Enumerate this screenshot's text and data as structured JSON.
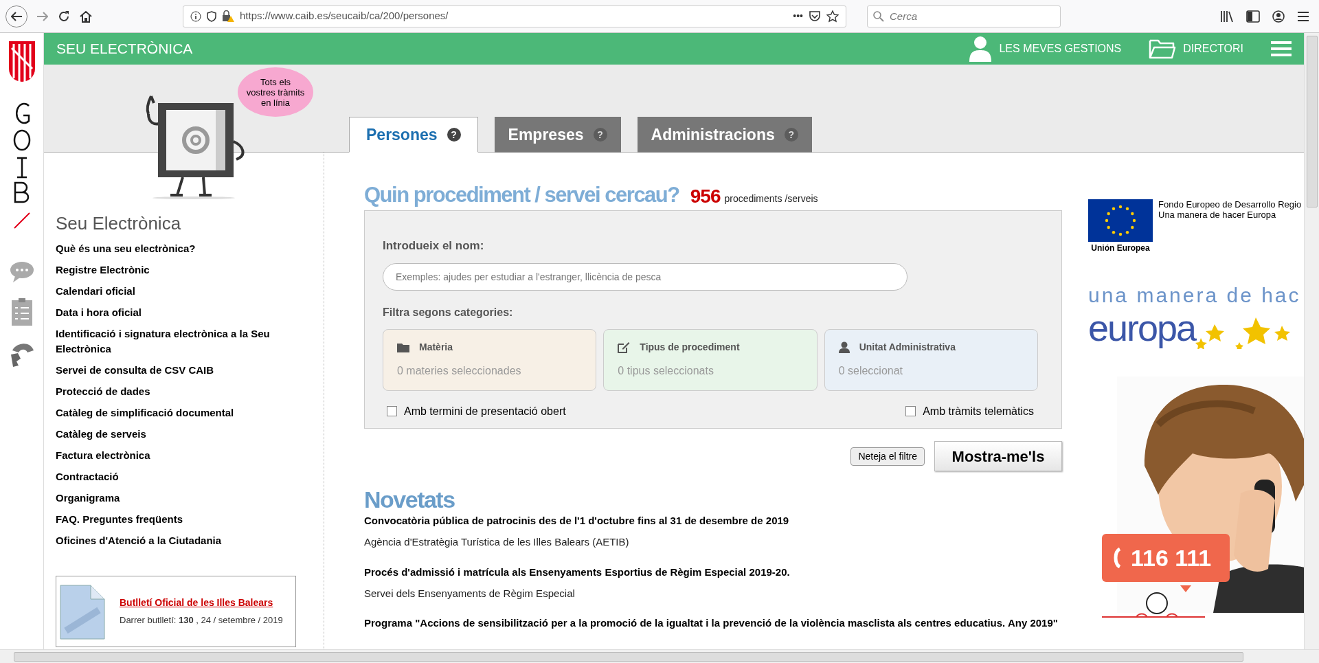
{
  "browser": {
    "url": "https://www.caib.es/seucaib/ca/200/persones/",
    "more": "•••",
    "search_placeholder": "Cerca"
  },
  "header": {
    "title": "SEU ELECTRÒNICA",
    "links": [
      {
        "kind": "user",
        "label": "LES MEVES GESTIONS"
      },
      {
        "kind": "folder",
        "label": "DIRECTORI"
      }
    ]
  },
  "banner": {
    "bubble": "Tots els vostres tràmits en línia"
  },
  "tabs": [
    {
      "label": "Persones",
      "help": "?",
      "selected": true
    },
    {
      "label": "Empreses",
      "help": "?",
      "selected": false
    },
    {
      "label": "Administracions",
      "help": "?",
      "selected": false
    }
  ],
  "sidebar": {
    "title": "Seu Electrònica",
    "links": [
      "Què és una seu electrònica?",
      "Registre Electrònic",
      "Calendari oficial",
      "Data i hora oficial",
      "Identificació i signatura electrònica a la Seu Electrònica",
      "Servei de consulta de CSV CAIB",
      "Protecció de dades",
      "Catàleg de simplificació documental",
      "Catàleg de serveis",
      "Factura electrònica",
      "Contractació",
      "Organigrama",
      "FAQ. Preguntes freqüents",
      "Oficines d'Atenció a la Ciutadania"
    ],
    "boib": {
      "title": "Butlletí Oficial de les Illes Balears",
      "text": "Darrer butlletí: **130** , 24 / setembre / 2019"
    }
  },
  "search": {
    "heading": "Quin procediment / servei cercau?",
    "count": "956",
    "count_label": "procediments /serveis",
    "name_label": "Introdueix el nom:",
    "placeholder": "Exemples: ajudes per estudiar a l'estranger, llicència de pesca",
    "filter_label": "Filtra segons categories:",
    "categories": [
      {
        "kind": "folder",
        "title": "Matèria",
        "summary": "0  materies seleccionades",
        "color": "#f7f0e6"
      },
      {
        "kind": "edit",
        "title": "Tipus de procediment",
        "summary": "0  tipus seleccionats",
        "color": "#e8f5e9"
      },
      {
        "kind": "user",
        "title": "Unitat Administrativa",
        "summary": "0  seleccionat",
        "color": "#e9f0f7"
      }
    ],
    "checkboxes": [
      {
        "label": "Amb termini de presentació obert",
        "checked": false
      },
      {
        "label": "Amb tràmits telemàtics",
        "checked": false
      }
    ],
    "clear_button": "Neteja el filtre",
    "submit_button": "Mostra-me'ls"
  },
  "news": {
    "title": "Novetats",
    "items": [
      {
        "title": "Convocatòria pública de patrocinis des de l'1 d'octubre fins al 31 de desembre de 2019",
        "source": "Agència d'Estratègia Turística de les Illes Balears (AETIB)"
      },
      {
        "title": "Procés d'admissió i matrícula als Ensenyaments Esportius de Règim Especial 2019-20.",
        "source": "Servei dels Ensenyaments de Règim Especial"
      },
      {
        "title": "Programa \"Accions de sensibilització per a la promoció de la igualtat i la prevenció de la violència masclista als centres educatius. Any 2019\""
      }
    ]
  },
  "ads": {
    "eu_caption": "Unión Europea",
    "eu_lines": [
      "Fondo Europeo de Desarrollo Regio",
      "Una manera de hacer Europa"
    ],
    "slogan_top": "una manera de hac",
    "slogan_bottom": "europa",
    "helpline": "116 111"
  }
}
